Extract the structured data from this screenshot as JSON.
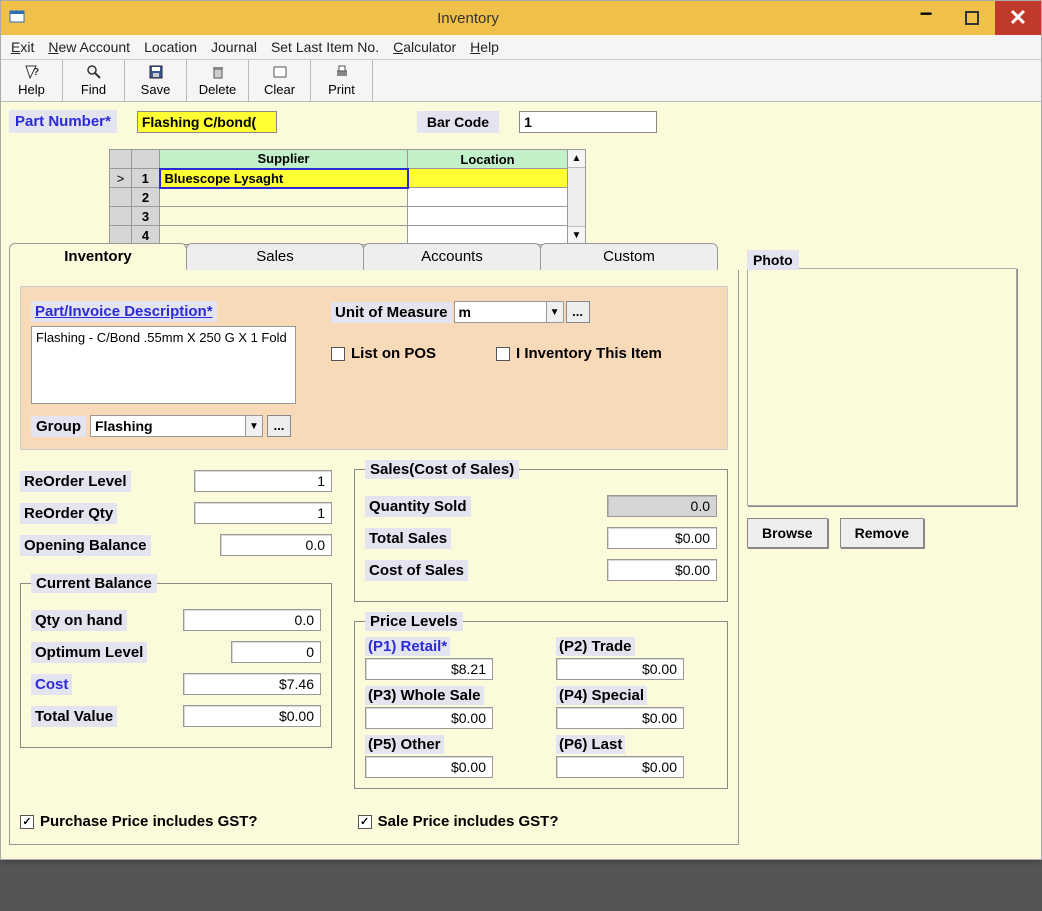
{
  "window_title": "Inventory",
  "menubar": {
    "exit": "Exit",
    "new_account": "New Account",
    "location": "Location",
    "journal": "Journal",
    "set_last": "Set Last Item No.",
    "calculator": "Calculator",
    "help": "Help"
  },
  "toolbar": {
    "help": "Help",
    "find": "Find",
    "save": "Save",
    "delete": "Delete",
    "clear": "Clear",
    "print": "Print"
  },
  "top": {
    "part_number_label": "Part Number*",
    "part_number": "Flashing C/bond(",
    "barcode_label": "Bar Code",
    "barcode": "1"
  },
  "grid": {
    "marker": ">",
    "col_supplier": "Supplier",
    "col_location": "Location",
    "rows": [
      {
        "n": "1",
        "supplier": "Bluescope Lysaght",
        "location": ""
      },
      {
        "n": "2",
        "supplier": "",
        "location": ""
      },
      {
        "n": "3",
        "supplier": "",
        "location": ""
      },
      {
        "n": "4",
        "supplier": "",
        "location": ""
      }
    ]
  },
  "tabs": {
    "inventory": "Inventory",
    "sales": "Sales",
    "accounts": "Accounts",
    "custom": "Custom"
  },
  "peach": {
    "desc_label": "Part/Invoice Description*",
    "desc": "Flashing - C/Bond .55mm X 250 G X 1 Fold",
    "group_label": "Group",
    "group": "Flashing",
    "uom_label": "Unit of Measure",
    "uom": "m",
    "dots": "...",
    "list_on_pos": "List on POS",
    "inv_this_item": "I Inventory This Item"
  },
  "reorder": {
    "level_label": "ReOrder Level",
    "level": "1",
    "qty_label": "ReOrder Qty",
    "qty": "1",
    "opening_label": "Opening Balance",
    "opening": "0.0"
  },
  "sales": {
    "legend": "Sales(Cost of Sales)",
    "qty_sold_label": "Quantity Sold",
    "qty_sold": "0.0",
    "total_label": "Total Sales",
    "total": "$0.00",
    "cos_label": "Cost of Sales",
    "cos": "$0.00"
  },
  "current": {
    "legend": "Current Balance",
    "qoh_label": "Qty on hand",
    "qoh": "0.0",
    "opt_label": "Optimum Level",
    "opt": "0",
    "cost_label": "Cost",
    "cost": "$7.46",
    "total_label": "Total Value",
    "total": "$0.00"
  },
  "price_levels": {
    "legend": "Price Levels",
    "p1_label": "(P1) Retail*",
    "p1": "$8.21",
    "p2_label": "(P2) Trade",
    "p2": "$0.00",
    "p3_label": "(P3) Whole Sale",
    "p3": "$0.00",
    "p4_label": "(P4) Special",
    "p4": "$0.00",
    "p5_label": "(P5) Other",
    "p5": "$0.00",
    "p6_label": "(P6) Last",
    "p6": "$0.00"
  },
  "gst": {
    "purchase": "Purchase Price includes GST?",
    "sale": "Sale Price includes GST?"
  },
  "photo": {
    "label": "Photo",
    "browse": "Browse",
    "remove": "Remove"
  }
}
